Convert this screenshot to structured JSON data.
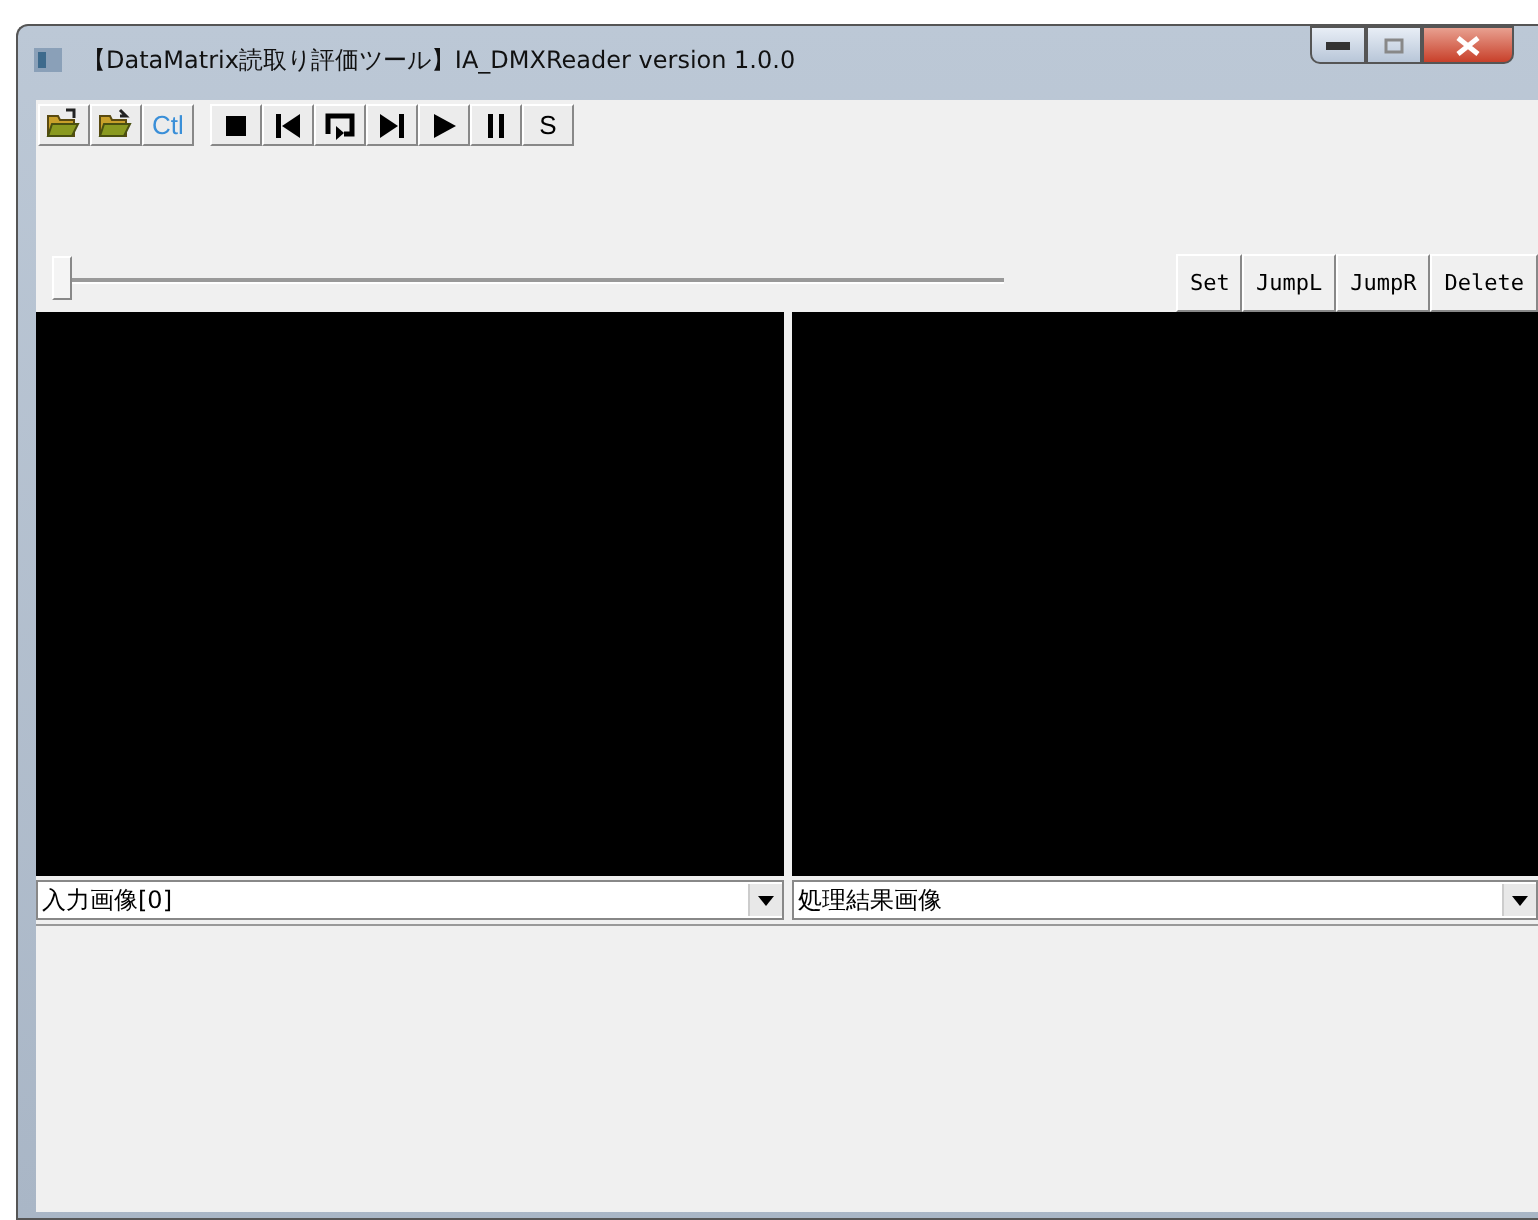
{
  "window": {
    "title": "【DataMatrix読取り評価ツール】IA_DMXReader version 1.0.0"
  },
  "toolbar": [
    {
      "kind": "open"
    },
    {
      "kind": "open2"
    },
    {
      "kind": "text",
      "label": "Ctl",
      "color": "#3a8fd8"
    },
    {
      "kind": "stop"
    },
    {
      "kind": "prev"
    },
    {
      "kind": "loop"
    },
    {
      "kind": "next"
    },
    {
      "kind": "play"
    },
    {
      "kind": "pause"
    },
    {
      "kind": "text",
      "label": "S",
      "color": "#000000"
    }
  ],
  "slider": {
    "level": 0
  },
  "buttons": [
    "Set",
    "JumpL",
    "JumpR",
    "Delete"
  ],
  "panels": [
    {
      "selection": "入力画像[0]"
    },
    {
      "selection": "処理結果画像"
    }
  ]
}
